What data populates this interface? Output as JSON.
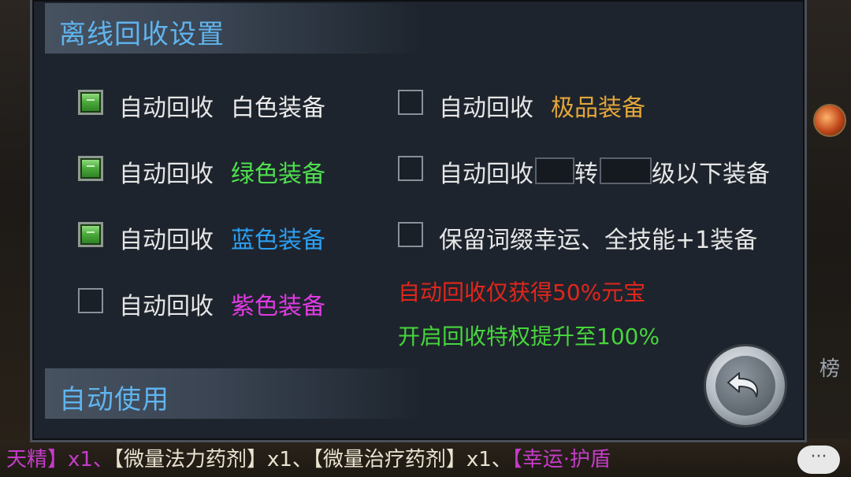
{
  "dialog": {
    "title": "离线回收设置",
    "auto_use_title": "自动使用"
  },
  "options_left": [
    {
      "prefix": "自动回收",
      "quality": "白色装备",
      "checked": true,
      "color": "#ececec"
    },
    {
      "prefix": "自动回收",
      "quality": "绿色装备",
      "checked": true,
      "color": "#4ee04e"
    },
    {
      "prefix": "自动回收",
      "quality": "蓝色装备",
      "checked": true,
      "color": "#2c9ff2"
    },
    {
      "prefix": "自动回收",
      "quality": "紫色装备",
      "checked": false,
      "color": "#e03be3"
    }
  ],
  "options_right": {
    "top": {
      "prefix": "自动回收",
      "quality": "极品装备",
      "checked": false,
      "color": "#e2a63a"
    },
    "level": {
      "prefix": "自动回收",
      "mid": "转",
      "suffix": "级以下装备",
      "checked": false,
      "zhuan_value": "",
      "level_value": ""
    },
    "keep": {
      "label": "保留词缀幸运、全技能+1装备",
      "checked": false
    }
  },
  "notes": {
    "red": "自动回收仅获得50%元宝",
    "green": "开启回收特权提升至100%"
  },
  "background": {
    "chat_line": [
      "天精】x1、",
      "【微量法力药剂】x1、【微量治疗药剂】x1、",
      "【幸运·护盾"
    ],
    "right_rank": "榜",
    "chat_bubble": "···"
  },
  "icons": {
    "back": "back-arrow-icon"
  }
}
